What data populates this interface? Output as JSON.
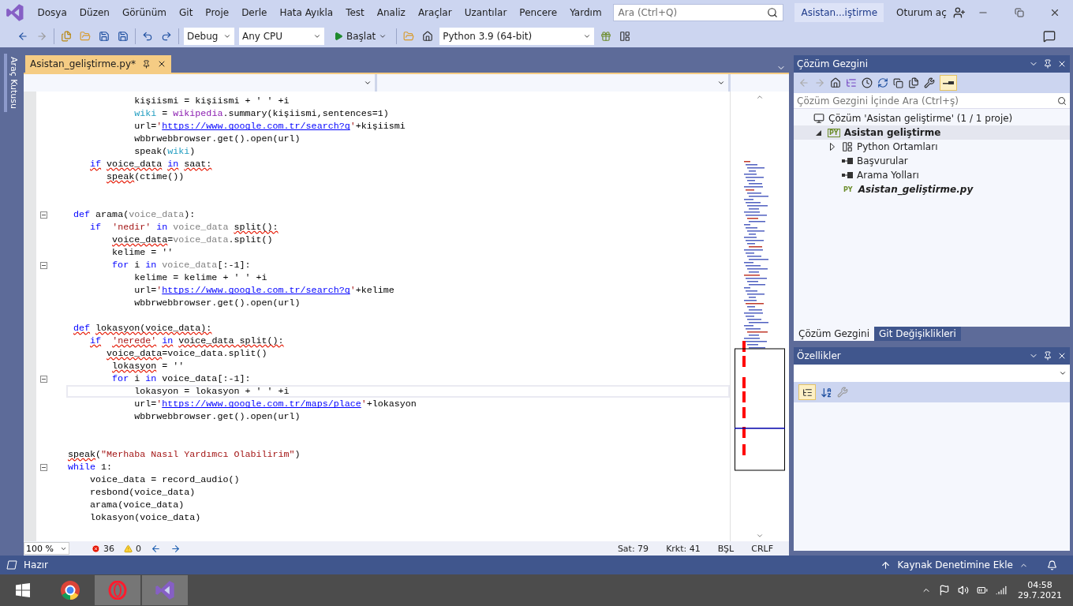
{
  "menu": {
    "items": [
      "Dosya",
      "Düzen",
      "Görünüm",
      "Git",
      "Proje",
      "Derle",
      "Hata Ayıkla",
      "Test",
      "Analiz",
      "Araçlar",
      "Uzantılar",
      "Pencere",
      "Yardım"
    ],
    "search_placeholder": "Ara (Ctrl+Q)",
    "solution_name": "Asistan...iştirme",
    "sign_in": "Oturum aç"
  },
  "toolbar": {
    "configuration": "Debug",
    "platform": "Any CPU",
    "start": "Başlat",
    "environment": "Python 3.9 (64-bit)"
  },
  "side_tab": "Araç Kutusu",
  "editor": {
    "tab": {
      "title": "Asistan_geliştirme.py*",
      "selected": true
    },
    "lines": [
      {
        "fold": false,
        "current": false,
        "tokens": [
          {
            "kind": "plain",
            "text": "            kişiismi = kişiismi + ' ' +i"
          }
        ]
      },
      {
        "fold": false,
        "current": false,
        "tokens": [
          {
            "kind": "var",
            "text": "            wiki"
          },
          {
            "kind": "plain",
            "text": " = "
          },
          {
            "kind": "mod",
            "text": "wikipedia"
          },
          {
            "kind": "plain",
            "text": ".summary(kişiismi,sentences=1)"
          }
        ]
      },
      {
        "fold": false,
        "current": false,
        "tokens": [
          {
            "kind": "plain",
            "text": "            url="
          },
          {
            "kind": "str",
            "text": "'"
          },
          {
            "kind": "url",
            "text": "https://www.google.com.tr/search?q"
          },
          {
            "kind": "str",
            "text": "'"
          },
          {
            "kind": "plain",
            "text": "+kişiismi"
          }
        ]
      },
      {
        "fold": false,
        "current": false,
        "tokens": [
          {
            "kind": "plain",
            "text": "            wbbrwebbrowser.get().open(url)"
          }
        ]
      },
      {
        "fold": false,
        "current": false,
        "tokens": [
          {
            "kind": "plain",
            "text": "            speak("
          },
          {
            "kind": "var",
            "text": "wiki"
          },
          {
            "kind": "plain",
            "text": ")"
          }
        ]
      },
      {
        "fold": false,
        "current": false,
        "tokens": [
          {
            "kind": "errkw",
            "text": "    if"
          },
          {
            "kind": "err",
            "text": " voice_data"
          },
          {
            "kind": "errkw",
            "text": " in"
          },
          {
            "kind": "err",
            "text": " saat:"
          }
        ]
      },
      {
        "fold": false,
        "current": false,
        "tokens": [
          {
            "kind": "err",
            "text": "       speak"
          },
          {
            "kind": "plain",
            "text": "(ctime())"
          }
        ]
      },
      {
        "fold": false,
        "current": false
      },
      {
        "fold": false,
        "current": false
      },
      {
        "fold": true,
        "current": false,
        "tokens": [
          {
            "kind": "kw",
            "text": " def"
          },
          {
            "kind": "plain",
            "text": " arama("
          },
          {
            "kind": "param",
            "text": "voice_data"
          },
          {
            "kind": "plain",
            "text": "):"
          }
        ]
      },
      {
        "fold": false,
        "current": false,
        "tokens": [
          {
            "kind": "kw",
            "text": "    if"
          },
          {
            "kind": "str",
            "text": "  'nedir'"
          },
          {
            "kind": "kw",
            "text": " in"
          },
          {
            "kind": "param",
            "text": " voice_data"
          },
          {
            "kind": "err",
            "text": " split():"
          }
        ]
      },
      {
        "fold": false,
        "current": false,
        "tokens": [
          {
            "kind": "err",
            "text": "        voice_data"
          },
          {
            "kind": "plain",
            "text": "="
          },
          {
            "kind": "param",
            "text": "voice_data"
          },
          {
            "kind": "plain",
            "text": ".split()"
          }
        ]
      },
      {
        "fold": false,
        "current": false,
        "tokens": [
          {
            "kind": "plain",
            "text": "        kelime = ''"
          }
        ]
      },
      {
        "fold": true,
        "current": false,
        "tokens": [
          {
            "kind": "kw",
            "text": "        for"
          },
          {
            "kind": "plain",
            "text": " i "
          },
          {
            "kind": "kw",
            "text": "in"
          },
          {
            "kind": "param",
            "text": " voice_data"
          },
          {
            "kind": "plain",
            "text": "[:-1]:"
          }
        ]
      },
      {
        "fold": false,
        "current": false,
        "tokens": [
          {
            "kind": "plain",
            "text": "            kelime = kelime + ' ' +i"
          }
        ]
      },
      {
        "fold": false,
        "current": false,
        "tokens": [
          {
            "kind": "plain",
            "text": "            url="
          },
          {
            "kind": "str",
            "text": "'"
          },
          {
            "kind": "url",
            "text": "https://www.google.com.tr/search?q"
          },
          {
            "kind": "str",
            "text": "'"
          },
          {
            "kind": "plain",
            "text": "+kelime"
          }
        ]
      },
      {
        "fold": false,
        "current": false,
        "tokens": [
          {
            "kind": "plain",
            "text": "            wbbrwebbrowser.get().open(url)"
          }
        ]
      },
      {
        "fold": false,
        "current": false
      },
      {
        "fold": false,
        "current": false,
        "tokens": [
          {
            "kind": "errkw",
            "text": " def"
          },
          {
            "kind": "err",
            "text": " lokasyon(voice_data):"
          }
        ]
      },
      {
        "fold": false,
        "current": false,
        "tokens": [
          {
            "kind": "errkw",
            "text": "    if"
          },
          {
            "kind": "errstr",
            "text": "  'nerede'"
          },
          {
            "kind": "errkw",
            "text": " in"
          },
          {
            "kind": "err",
            "text": " voice_data split():"
          }
        ]
      },
      {
        "fold": false,
        "current": false,
        "tokens": [
          {
            "kind": "err",
            "text": "       voice_data"
          },
          {
            "kind": "plain",
            "text": "=voice_data.split()"
          }
        ]
      },
      {
        "fold": false,
        "current": false,
        "tokens": [
          {
            "kind": "err",
            "text": "        lokasyon"
          },
          {
            "kind": "plain",
            "text": " = ''"
          }
        ]
      },
      {
        "fold": true,
        "current": false,
        "tokens": [
          {
            "kind": "kw",
            "text": "        for"
          },
          {
            "kind": "plain",
            "text": " i "
          },
          {
            "kind": "kw",
            "text": "in"
          },
          {
            "kind": "plain",
            "text": " voice_data[:-1]:"
          }
        ]
      },
      {
        "fold": false,
        "current": true,
        "tokens": [
          {
            "kind": "plain",
            "text": "            lokasyon = lokasyon + ' ' +i"
          }
        ]
      },
      {
        "fold": false,
        "current": false,
        "tokens": [
          {
            "kind": "plain",
            "text": "            url="
          },
          {
            "kind": "str",
            "text": "'"
          },
          {
            "kind": "url",
            "text": "https://www.google.com.tr/maps/place"
          },
          {
            "kind": "str",
            "text": "'"
          },
          {
            "kind": "plain",
            "text": "+lokasyon"
          }
        ]
      },
      {
        "fold": false,
        "current": false,
        "tokens": [
          {
            "kind": "plain",
            "text": "            wbbrwebbrowser.get().open(url)"
          }
        ]
      },
      {
        "fold": false,
        "current": false
      },
      {
        "fold": false,
        "current": false
      },
      {
        "fold": false,
        "current": false,
        "tokens": [
          {
            "kind": "err",
            "text": "speak"
          },
          {
            "kind": "plain",
            "text": "("
          },
          {
            "kind": "str",
            "text": "\"Merhaba Nasıl Yardımcı Olabilirim\""
          },
          {
            "kind": "plain",
            "text": ")"
          }
        ]
      },
      {
        "fold": true,
        "current": false,
        "tokens": [
          {
            "kind": "kw",
            "text": "while"
          },
          {
            "kind": "plain",
            "text": " 1:"
          }
        ]
      },
      {
        "fold": false,
        "current": false,
        "tokens": [
          {
            "kind": "plain",
            "text": "    voice_data = record_audio()"
          }
        ]
      },
      {
        "fold": false,
        "current": false,
        "tokens": [
          {
            "kind": "plain",
            "text": "    resbond(voice_data)"
          }
        ]
      },
      {
        "fold": false,
        "current": false,
        "tokens": [
          {
            "kind": "plain",
            "text": "    arama(voice_data)"
          }
        ]
      },
      {
        "fold": false,
        "current": false,
        "tokens": [
          {
            "kind": "plain",
            "text": "    lokasyon(voice_data)"
          }
        ]
      }
    ],
    "zoom": "100 %",
    "errors": "36",
    "warnings": "0",
    "position": [
      "Sat: 79",
      "Krkt: 41",
      "BŞL",
      "CRLF"
    ]
  },
  "solution_explorer": {
    "title": "Çözüm Gezgini",
    "search_placeholder": "Çözüm Gezgini İçinde Ara (Ctrl+ş)",
    "tree": [
      {
        "kind": "solution",
        "label": "Çözüm 'Asistan geliştirme' (1 / 1 proje)",
        "selected": false,
        "children": [
          {
            "kind": "project",
            "badge": "PY",
            "label": "Asistan geliştirme",
            "selected": true,
            "expanded": true,
            "children": [
              {
                "kind": "env",
                "label": "Python Ortamları",
                "selected": false,
                "expanded": false
              },
              {
                "kind": "ref",
                "label": "Başvurular",
                "selected": false
              },
              {
                "kind": "ref",
                "label": "Arama Yolları",
                "selected": false
              },
              {
                "kind": "pyfile",
                "badge": "PY",
                "label": "Asistan_geliştirme.py",
                "selected": false
              }
            ]
          }
        ]
      }
    ],
    "tabs": [
      {
        "label": "Çözüm Gezgini",
        "selected": true
      },
      {
        "label": "Git Değişiklikleri",
        "selected": false
      }
    ]
  },
  "properties": {
    "title": "Özellikler"
  },
  "status_bar": {
    "text": "Hazır",
    "source_control": "Kaynak Denetimine Ekle"
  },
  "taskbar": {
    "time": "04:58",
    "date": "29.7.2021"
  }
}
